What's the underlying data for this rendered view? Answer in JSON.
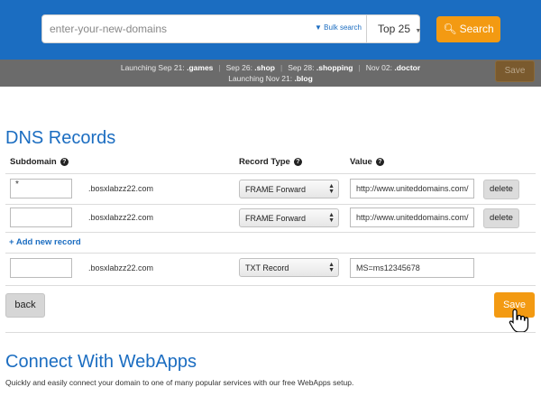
{
  "header": {
    "search_placeholder": "enter-your-new-domains",
    "bulk_search_label": "Bulk search",
    "top_select_value": "Top 25",
    "search_button_label": "Search"
  },
  "ticker": {
    "items": [
      {
        "prefix": "Launching Sep 21: ",
        "tld": ".games"
      },
      {
        "prefix": "Sep 26: ",
        "tld": ".shop"
      },
      {
        "prefix": "Sep 28: ",
        "tld": ".shopping"
      },
      {
        "prefix": "Nov 02: ",
        "tld": ".doctor"
      }
    ],
    "line2_prefix": "Launching Nov 21: ",
    "line2_tld": ".blog",
    "save_label": "Save"
  },
  "dns": {
    "title": "DNS Records",
    "columns": {
      "subdomain": "Subdomain",
      "record_type": "Record Type",
      "value": "Value"
    },
    "help_glyph": "?",
    "records": [
      {
        "subdomain": "*",
        "domain": ".bosxlabzz22.com",
        "type": "FRAME Forward",
        "value": "http://www.uniteddomains.com/",
        "delete_label": "delete"
      },
      {
        "subdomain": "",
        "domain": ".bosxlabzz22.com",
        "type": "FRAME Forward",
        "value": "http://www.uniteddomains.com/",
        "delete_label": "delete"
      }
    ],
    "add_record_label": "+ Add new record",
    "new_record": {
      "subdomain": "",
      "domain": ".bosxlabzz22.com",
      "type": "TXT Record",
      "value": "MS=ms12345678"
    },
    "back_label": "back",
    "save_label": "Save"
  },
  "webapps": {
    "title": "Connect With WebApps",
    "description": "Quickly and easily connect your domain to one of many popular services with our free WebApps setup."
  },
  "colors": {
    "brand_blue": "#1b6dc1",
    "accent_orange": "#f39a12",
    "ticker_gray": "#6b6b6b"
  },
  "icons": {
    "search": "magnifier-icon",
    "help": "question-circle-icon",
    "bulk_caret": "caret-down-icon",
    "select_arrows": "select-arrows-icon",
    "cursor": "hand-pointer-icon"
  }
}
